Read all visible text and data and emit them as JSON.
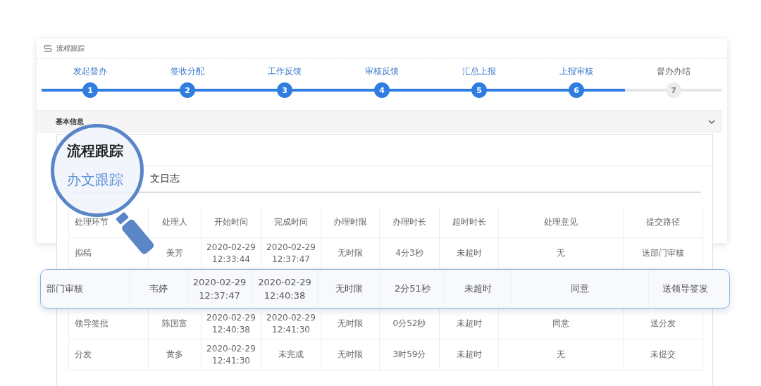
{
  "panel": {
    "title": "流程跟踪"
  },
  "steps": [
    {
      "label": "发起督办",
      "number": "1",
      "done": true
    },
    {
      "label": "签收分配",
      "number": "2",
      "done": true
    },
    {
      "label": "工作反馈",
      "number": "3",
      "done": true
    },
    {
      "label": "审核反馈",
      "number": "4",
      "done": true
    },
    {
      "label": "汇总上报",
      "number": "5",
      "done": true
    },
    {
      "label": "上报审核",
      "number": "6",
      "done": true
    },
    {
      "label": "督办办结",
      "number": "7",
      "done": false
    }
  ],
  "section": {
    "title": "基本信息"
  },
  "magnifier": {
    "heading": "流程跟踪",
    "tab": "办文跟踪"
  },
  "tab_fragment": "文日志",
  "table": {
    "columns": [
      "处理环节",
      "处理人",
      "开始时间",
      "完成时间",
      "办理时限",
      "办理时长",
      "超时时长",
      "处理意见",
      "提交路径"
    ],
    "rows": [
      {
        "highlighted": false,
        "cells": [
          "拟稿",
          "美芳",
          "2020-02-29 12:33:44",
          "2020-02-29 12:37:47",
          "无时限",
          "4分3秒",
          "未超时",
          "无",
          "送部门审核"
        ]
      },
      {
        "highlighted": true,
        "cells": [
          "部门审核",
          "韦婷",
          "2020-02-29 12:37:47",
          "2020-02-29 12:40:38",
          "无时限",
          "2分51秒",
          "未超时",
          "同意",
          "送领导签发"
        ]
      },
      {
        "highlighted": false,
        "cells": [
          "领导签批",
          "陈国富",
          "2020-02-29 12:40:38",
          "2020-02-29 12:41:30",
          "无时限",
          "0分52秒",
          "未超时",
          "同意",
          "送分发"
        ]
      },
      {
        "highlighted": false,
        "cells": [
          "分发",
          "黄多",
          "2020-02-29 12:41:30",
          "未完成",
          "无时限",
          "3时59分",
          "未超时",
          "无",
          "未提交"
        ]
      }
    ]
  }
}
